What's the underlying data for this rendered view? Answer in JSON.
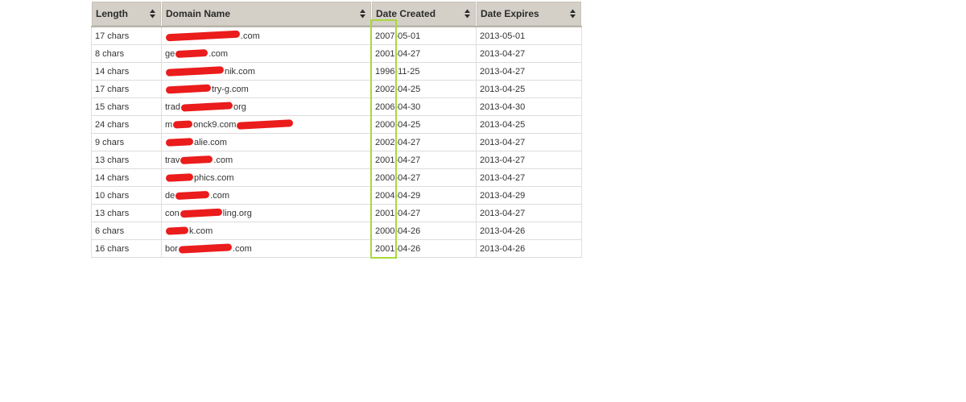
{
  "table": {
    "headers": [
      {
        "label": "Length"
      },
      {
        "label": "Domain Name"
      },
      {
        "label": "Date Created"
      },
      {
        "label": "Date Expires"
      }
    ],
    "rows": [
      {
        "length": "17 chars",
        "domain_prefix": "",
        "domain_suffix": ".com",
        "created": "2007-05-01",
        "expires": "2013-05-01"
      },
      {
        "length": "8 chars",
        "domain_prefix": "ge",
        "domain_suffix": ".com",
        "created": "2001-04-27",
        "expires": "2013-04-27"
      },
      {
        "length": "14 chars",
        "domain_prefix": "",
        "domain_suffix": "nik.com",
        "created": "1996-11-25",
        "expires": "2013-04-27"
      },
      {
        "length": "17 chars",
        "domain_prefix": "",
        "domain_suffix": "try-g.com",
        "created": "2002-04-25",
        "expires": "2013-04-25"
      },
      {
        "length": "15 chars",
        "domain_prefix": "trad",
        "domain_suffix": "org",
        "created": "2006-04-30",
        "expires": "2013-04-30"
      },
      {
        "length": "24 chars",
        "domain_prefix": "m",
        "domain_suffix": "onck9.com",
        "created": "2000-04-25",
        "expires": "2013-04-25"
      },
      {
        "length": "9 chars",
        "domain_prefix": "",
        "domain_suffix": "alie.com",
        "created": "2002-04-27",
        "expires": "2013-04-27"
      },
      {
        "length": "13 chars",
        "domain_prefix": "trav",
        "domain_suffix": ".com",
        "created": "2001-04-27",
        "expires": "2013-04-27"
      },
      {
        "length": "14 chars",
        "domain_prefix": "",
        "domain_suffix": "phics.com",
        "created": "2000-04-27",
        "expires": "2013-04-27"
      },
      {
        "length": "10 chars",
        "domain_prefix": "de",
        "domain_suffix": ".com",
        "created": "2004-04-29",
        "expires": "2013-04-29"
      },
      {
        "length": "13 chars",
        "domain_prefix": "con",
        "domain_suffix": "ling.org",
        "created": "2001-04-27",
        "expires": "2013-04-27"
      },
      {
        "length": "6 chars",
        "domain_prefix": "",
        "domain_suffix": "k.com",
        "created": "2000-04-26",
        "expires": "2013-04-26"
      },
      {
        "length": "16 chars",
        "domain_prefix": "bor",
        "domain_suffix": ".com",
        "created": "2001-04-26",
        "expires": "2013-04-26"
      }
    ]
  },
  "colors": {
    "header_bg": "#d4d0c8",
    "redaction": "#ea1c1c",
    "highlight": "#a8d93b"
  },
  "icons": {
    "sort": "sort-icon"
  }
}
